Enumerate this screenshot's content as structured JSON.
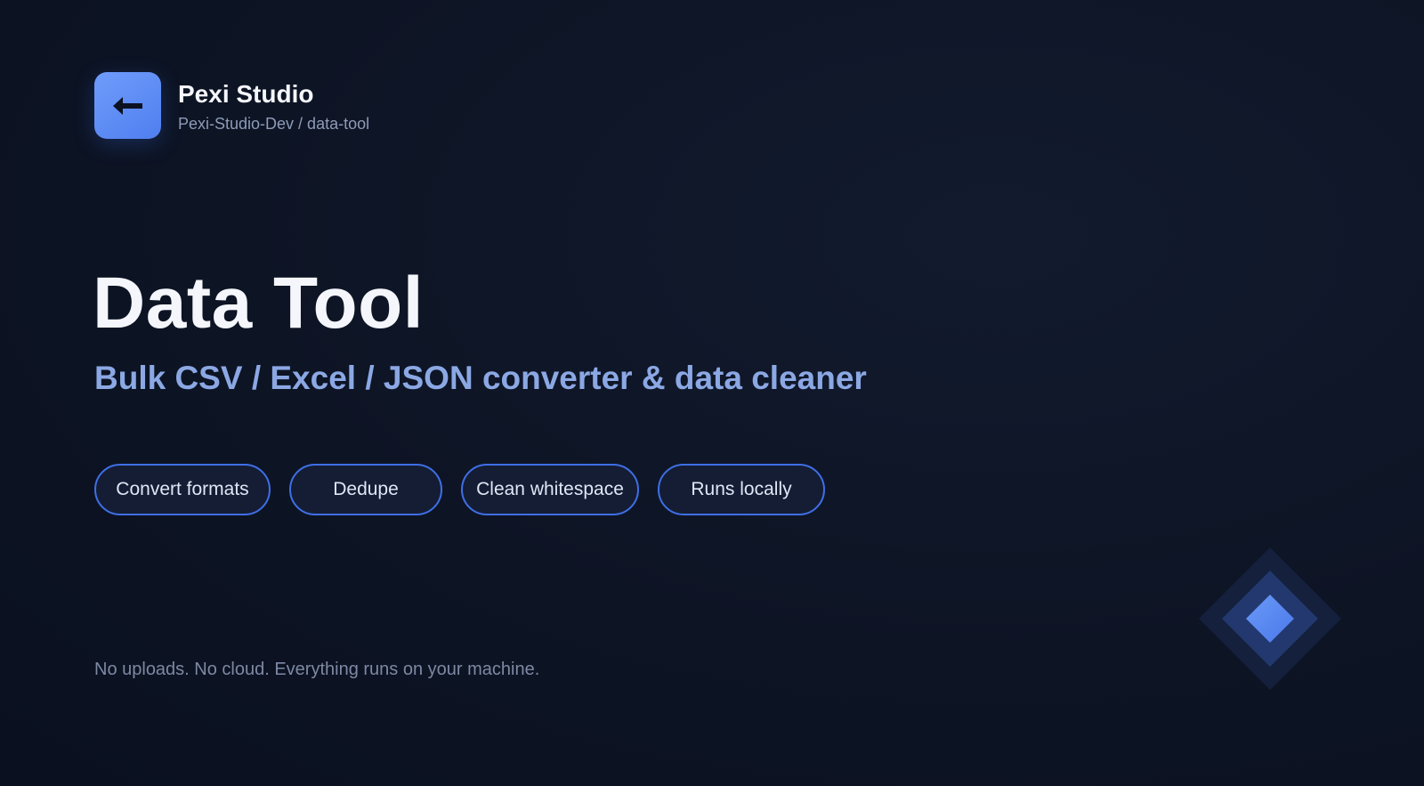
{
  "header": {
    "logo_icon": "left-arrow-icon",
    "brand_name": "Pexi Studio",
    "repo_path": "Pexi-Studio-Dev / data-tool"
  },
  "hero": {
    "title": "Data Tool",
    "subtitle": "Bulk CSV / Excel / JSON converter & data cleaner"
  },
  "features": [
    {
      "label": "Convert formats"
    },
    {
      "label": "Dedupe"
    },
    {
      "label": "Clean whitespace"
    },
    {
      "label": "Runs locally"
    }
  ],
  "footnote": "No uploads. No cloud. Everything runs on your machine.",
  "decoration": {
    "icon": "layered-diamond-icon"
  },
  "colors": {
    "background": "#0d1424",
    "accent": "#4f7ff0",
    "pill_border": "#3f6fe6",
    "subtitle": "#8ba8e4"
  }
}
